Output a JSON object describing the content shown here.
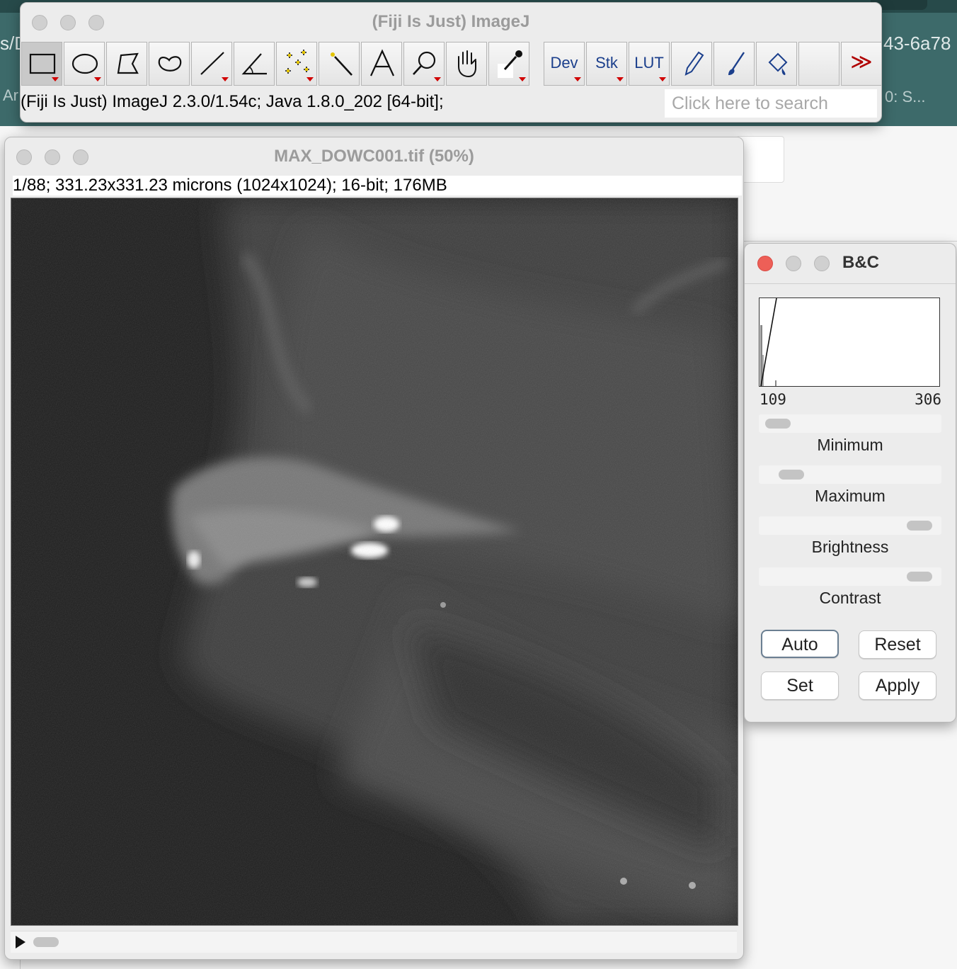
{
  "background": {
    "frag_left_top": "s/D",
    "frag_right_top": "43-6a78",
    "frag_left_mid": "Ar",
    "frag_right_mid": "0: S..."
  },
  "imagej": {
    "title": "(Fiji Is Just) ImageJ",
    "tools": [
      {
        "name": "rectangle-tool",
        "icon": "rectangle-icon"
      },
      {
        "name": "oval-tool",
        "icon": "oval-icon"
      },
      {
        "name": "polygon-tool",
        "icon": "polygon-icon"
      },
      {
        "name": "freehand-tool",
        "icon": "freehand-icon"
      },
      {
        "name": "line-tool",
        "icon": "line-icon"
      },
      {
        "name": "angle-tool",
        "icon": "angle-icon"
      },
      {
        "name": "multipoint-tool",
        "icon": "multipoint-icon"
      },
      {
        "name": "wand-tool",
        "icon": "wand-icon"
      },
      {
        "name": "text-tool",
        "icon": "text-icon"
      },
      {
        "name": "magnifier-tool",
        "icon": "magnifier-icon"
      },
      {
        "name": "hand-tool",
        "icon": "hand-icon"
      },
      {
        "name": "color-picker-tool",
        "icon": "dropper-icon"
      }
    ],
    "menu_tools": {
      "dev": "Dev",
      "stk": "Stk",
      "lut": "LUT"
    },
    "more_tools_glyph": "≫",
    "status_text": "(Fiji Is Just) ImageJ 2.3.0/1.54c; Java 1.8.0_202 [64-bit];",
    "search_placeholder": "Click here to search"
  },
  "image_window": {
    "title": "MAX_DOWC001.tif (50%)",
    "info": "1/88; 331.23x331.23 microns (1024x1024); 16-bit; 176MB"
  },
  "bc": {
    "title": "B&C",
    "hist_min": "109",
    "hist_max": "306",
    "sliders": [
      {
        "label": "Minimum",
        "position": 0.03
      },
      {
        "label": "Maximum",
        "position": 0.12
      },
      {
        "label": "Brightness",
        "position": 0.95
      },
      {
        "label": "Contrast",
        "position": 0.95
      }
    ],
    "buttons": {
      "auto": "Auto",
      "reset": "Reset",
      "set": "Set",
      "apply": "Apply"
    }
  }
}
